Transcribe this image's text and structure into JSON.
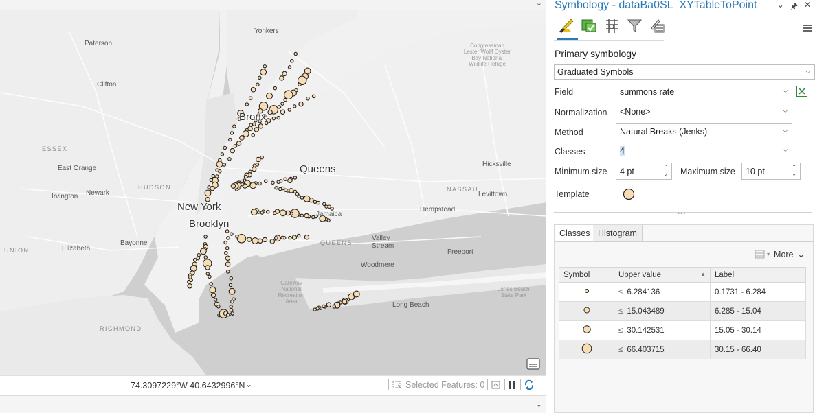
{
  "map": {
    "labels": {
      "yonkers": "Yonkers",
      "paterson": "Paterson",
      "clifton": "Clifton",
      "essex": "ESSEX",
      "east_orange": "East Orange",
      "hudson": "HUDSON",
      "newark": "Newark",
      "irvington": "Irvington",
      "new_york": "New York",
      "brooklyn": "Brooklyn",
      "bronx": "Bronx",
      "queens": "Queens",
      "bayonne": "Bayonne",
      "elizabeth": "Elizabeth",
      "union": "UNION",
      "richmond": "RICHMOND",
      "hicksville": "Hicksville",
      "nassau": "NASSAU",
      "levittown": "Levittown",
      "hempstead": "Hempstead",
      "valley_stream": "Valley Stream",
      "queens_cap": "QUEENS",
      "freeport": "Freeport",
      "woodmere": "Woodmere",
      "long_beach": "Long Beach",
      "jamaica": "Jamaica",
      "gateway": "Gateway National Recreation Area",
      "congressman": "Congressman Lester Wolff Oyster Bay National Wildlife Refuge",
      "jones_beach": "Jones Beach State Park"
    }
  },
  "status": {
    "coordinates": "74.3097229°W 40.6432996°N",
    "selected_features": "Selected Features: 0"
  },
  "panel": {
    "title": "Symbology - dataBa0SL_XYTableToPoint",
    "primary_title": "Primary symbology",
    "symbology_type": "Graduated Symbols",
    "field_label": "Field",
    "field_value": "summons rate",
    "normalization_label": "Normalization",
    "normalization_value": "<None>",
    "method_label": "Method",
    "method_value": "Natural Breaks (Jenks)",
    "classes_label": "Classes",
    "classes_value": "4",
    "min_size_label": "Minimum size",
    "min_size_value": "4 pt",
    "max_size_label": "Maximum size",
    "max_size_value": "10 pt",
    "template_label": "Template",
    "tab_classes": "Classes",
    "tab_histogram": "Histogram",
    "more_label": "More",
    "table_headers": {
      "symbol": "Symbol",
      "upper": "Upper value",
      "label": "Label"
    },
    "le": "≤",
    "classes": [
      {
        "upper": "6.284136",
        "label": "0.1731 - 6.284"
      },
      {
        "upper": "15.043489",
        "label": "6.285 - 15.04"
      },
      {
        "upper": "30.142531",
        "label": "15.05 - 30.14"
      },
      {
        "upper": "66.403715",
        "label": "30.15 - 66.40"
      }
    ]
  },
  "colors": {
    "symbol_fill": "#f8dcb4",
    "accent": "#2a7ab8",
    "water": "#d2d2d2",
    "land": "#f2f2f2"
  }
}
